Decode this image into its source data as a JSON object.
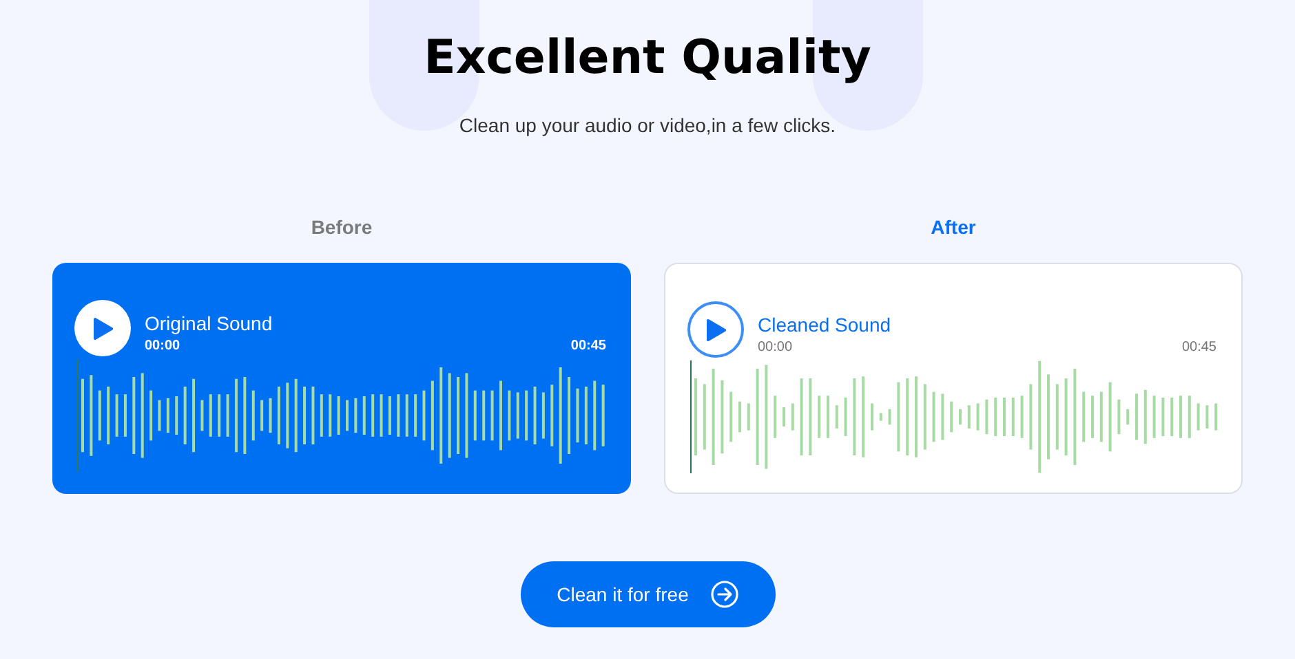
{
  "heading": "Excellent Quality",
  "subheading": "Clean up your audio or video,in a few clicks.",
  "players": [
    {
      "kind": "before",
      "label": "Before",
      "title": "Original Sound",
      "start_time": "00:00",
      "end_time": "00:45"
    },
    {
      "kind": "after",
      "label": "After",
      "title": "Cleaned Sound",
      "start_time": "00:00",
      "end_time": "00:45"
    }
  ],
  "cta": {
    "label": "Clean it for free"
  }
}
